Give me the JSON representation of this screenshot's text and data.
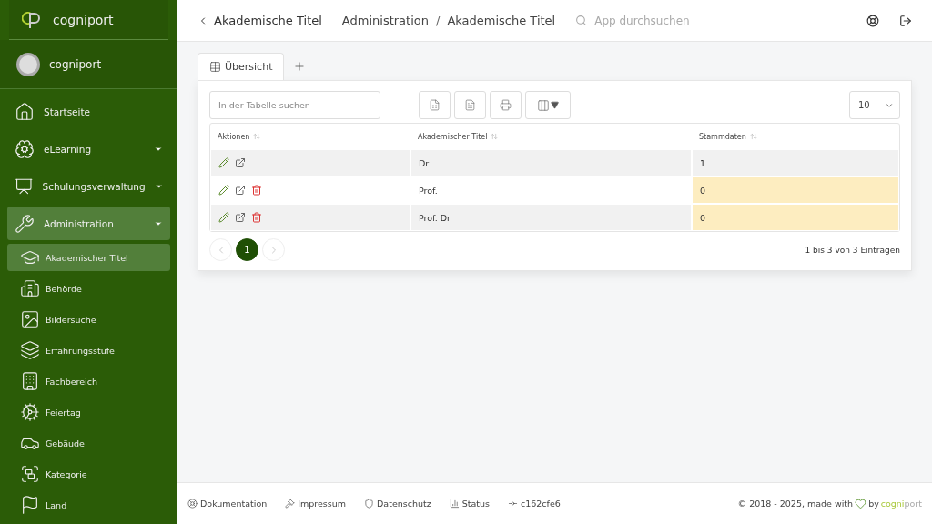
{
  "brand": {
    "name": "cogniport"
  },
  "profile": {
    "name": "cogniport"
  },
  "sidebar": {
    "items": [
      {
        "label": "Startseite",
        "selected": false,
        "submenu": false
      },
      {
        "label": "eLearning",
        "selected": false,
        "submenu": true
      },
      {
        "label": "Schulungsverwaltung",
        "selected": false,
        "submenu": true
      },
      {
        "label": "Administration",
        "selected": true,
        "submenu": true,
        "children": [
          {
            "label": "Akademischer Titel",
            "selected": true
          },
          {
            "label": "Behörde",
            "selected": false
          },
          {
            "label": "Bildersuche",
            "selected": false
          },
          {
            "label": "Erfahrungsstufe",
            "selected": false
          },
          {
            "label": "Fachbereich",
            "selected": false
          },
          {
            "label": "Feiertag",
            "selected": false
          },
          {
            "label": "Gebäude",
            "selected": false
          },
          {
            "label": "Kategorie",
            "selected": false
          },
          {
            "label": "Land",
            "selected": false
          }
        ]
      }
    ]
  },
  "header": {
    "page_title": "Akademische Titel",
    "breadcrumb": [
      "Administration",
      "Akademische Titel"
    ],
    "breadcrumb_separator": "/",
    "search": {
      "placeholder": "App durchsuchen"
    }
  },
  "tabs": [
    {
      "label": "Übersicht",
      "selected": true
    }
  ],
  "table_search": {
    "placeholder": "In der Tabelle suchen"
  },
  "page_size": "10",
  "table": {
    "columns": [
      "Aktionen",
      "Akademischer Titel",
      "Stammdaten"
    ],
    "rows": [
      {
        "title": "Dr.",
        "stammdaten": "1",
        "deletable": false,
        "highlighted": false
      },
      {
        "title": "Prof.",
        "stammdaten": "0",
        "deletable": true,
        "highlighted": true
      },
      {
        "title": "Prof. Dr.",
        "stammdaten": "0",
        "deletable": true,
        "highlighted": true
      }
    ]
  },
  "pagination": {
    "pages": [
      {
        "label": "1",
        "selected": true
      }
    ],
    "summary": "1 bis 3 von 3 Einträgen"
  },
  "footer": {
    "links": [
      "Dokumentation",
      "Impressum",
      "Datenschutz",
      "Status",
      "c162cfe6"
    ],
    "copyright": "© 2018 - 2025, made with",
    "by": "by",
    "brand_a": "cogni",
    "brand_b": "port"
  }
}
